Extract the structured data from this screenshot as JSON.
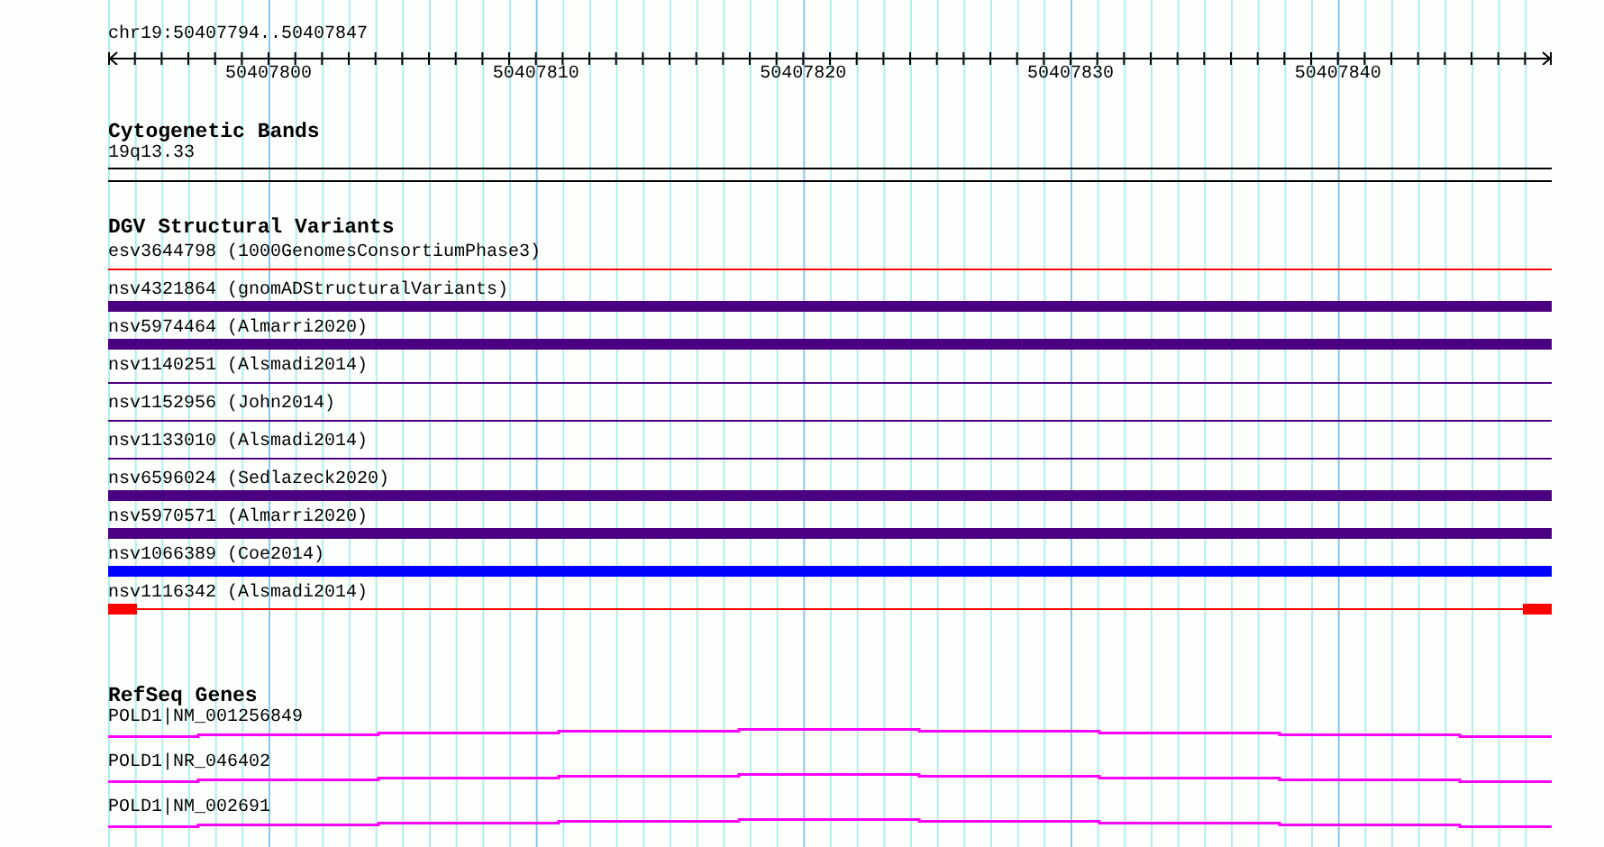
{
  "ruler": {
    "location": "chr19:50407794..50407847",
    "labels": [
      "50407800",
      "50407810",
      "50407820",
      "50407830",
      "50407840"
    ]
  },
  "tracks": [
    {
      "kind": "cytoband",
      "title": "Cytogenetic Bands",
      "features": [
        {
          "label": "19q13.33"
        }
      ]
    },
    {
      "kind": "variants",
      "title": "DGV Structural Variants",
      "features": [
        {
          "label": "esv3644798 (1000GenomesConsortiumPhase3)",
          "kind": "line",
          "color": "#ff0000"
        },
        {
          "label": "nsv4321864 (gnomADStructuralVariants)",
          "kind": "bar",
          "color": "#4b0082"
        },
        {
          "label": "nsv5974464 (Almarri2020)",
          "kind": "bar",
          "color": "#4b0082"
        },
        {
          "label": "nsv1140251 (Alsmadi2014)",
          "kind": "line",
          "color": "#4b0082"
        },
        {
          "label": "nsv1152956 (John2014)",
          "kind": "line",
          "color": "#4b0082"
        },
        {
          "label": "nsv1133010 (Alsmadi2014)",
          "kind": "line",
          "color": "#4b0082"
        },
        {
          "label": "nsv6596024 (Sedlazeck2020)",
          "kind": "bar",
          "color": "#4b0082"
        },
        {
          "label": "nsv5970571 (Almarri2020)",
          "kind": "bar",
          "color": "#4b0082"
        },
        {
          "label": "nsv1066389 (Coe2014)",
          "kind": "bar",
          "color": "#0000ff"
        },
        {
          "label": "nsv1116342 (Alsmadi2014)",
          "kind": "bounded",
          "color": "#ff0000"
        }
      ]
    },
    {
      "kind": "genes",
      "title": "RefSeq Genes",
      "features": [
        {
          "label": "POLD1|NM_001256849"
        },
        {
          "label": "POLD1|NR_046402"
        },
        {
          "label": "POLD1|NM_002691"
        }
      ]
    }
  ]
}
